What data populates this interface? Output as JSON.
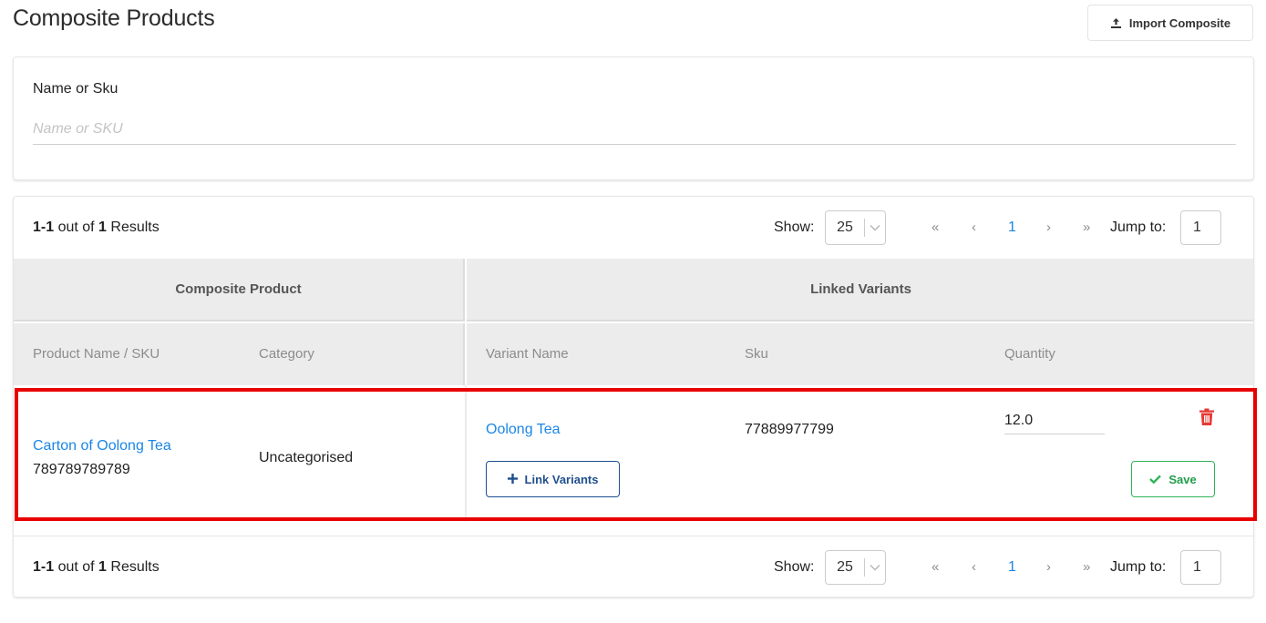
{
  "page": {
    "title": "Composite Products",
    "import_button_label": "Import Composite"
  },
  "filter": {
    "label": "Name or Sku",
    "placeholder": "Name or SKU",
    "value": ""
  },
  "pagination": {
    "results_range": "1-1",
    "results_out_of": " out of ",
    "results_total": "1",
    "results_suffix": " Results",
    "show_label": "Show:",
    "page_size": "25",
    "first": "«",
    "prev": "‹",
    "current_page": "1",
    "next": "›",
    "last": "»",
    "jump_label": "Jump to:",
    "jump_value": "1"
  },
  "table": {
    "group_headers": {
      "left": "Composite Product",
      "right": "Linked Variants"
    },
    "columns": {
      "product_name": "Product Name / SKU",
      "category": "Category",
      "variant_name": "Variant Name",
      "sku": "Sku",
      "quantity": "Quantity"
    },
    "rows": [
      {
        "product_name": "Carton of Oolong Tea",
        "product_sku": "789789789789",
        "category": "Uncategorised",
        "variants": [
          {
            "name": "Oolong Tea",
            "sku": "77889977799",
            "quantity": "12.0"
          }
        ],
        "link_variants_label": "Link Variants",
        "save_label": "Save"
      }
    ]
  },
  "colors": {
    "link": "#1a86e6",
    "header_bg": "#ececec",
    "delete": "#e53935",
    "save": "#2fb35a",
    "link_variants": "#1f4f8f",
    "highlight": "#e80000"
  }
}
